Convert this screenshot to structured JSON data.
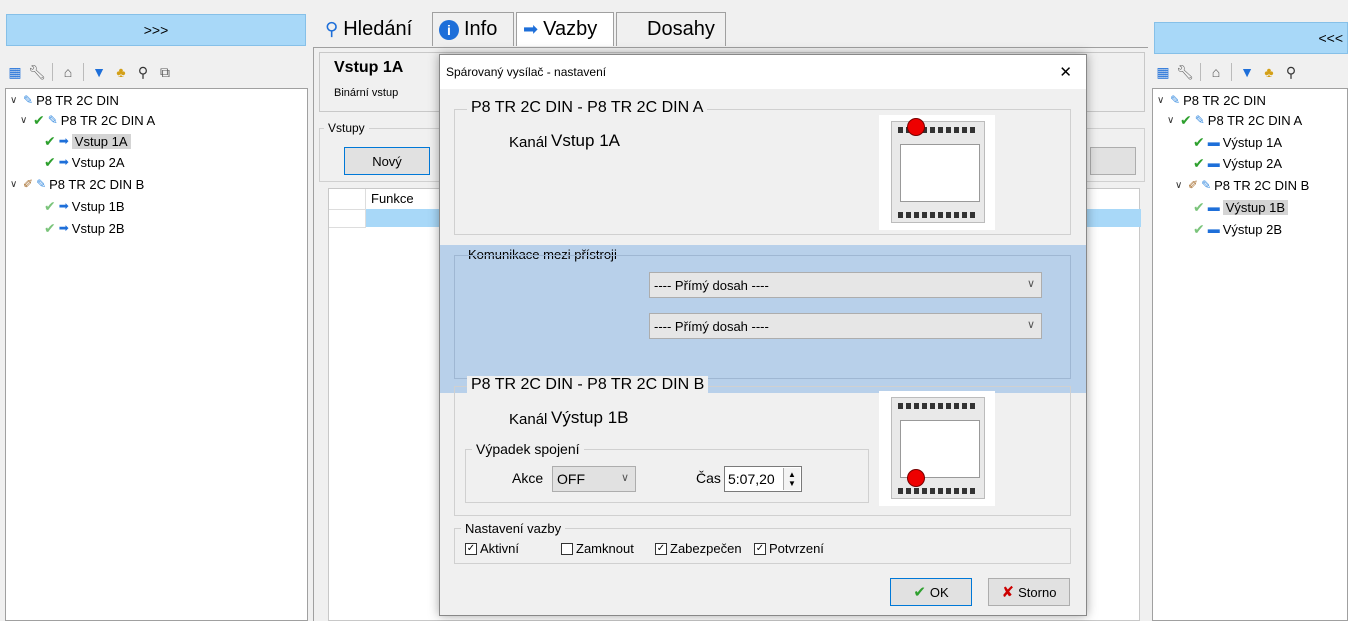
{
  "left_panel": {
    "collapse_label": ">>>",
    "tree": [
      {
        "label": "P8 TR 2C DIN"
      },
      {
        "label": "P8 TR 2C DIN A"
      },
      {
        "label": "Vstup 1A"
      },
      {
        "label": "Vstup 2A"
      },
      {
        "label": "P8 TR 2C DIN B"
      },
      {
        "label": "Vstup 1B"
      },
      {
        "label": "Vstup 2B"
      }
    ]
  },
  "tabs": [
    {
      "label": "Hledání",
      "icon": "search-icon"
    },
    {
      "label": "Info",
      "icon": "info-icon"
    },
    {
      "label": "Vazby",
      "icon": "arrow-right-icon"
    },
    {
      "label": "Dosahy",
      "icon": ""
    }
  ],
  "middle": {
    "title": "Vstup 1A",
    "subtitle": "Binární vstup",
    "group_label": "Vstupy",
    "new_button": "Nový",
    "table_header": "Funkce"
  },
  "right_panel": {
    "collapse_label": "<<<",
    "tree": [
      {
        "label": "P8 TR 2C DIN"
      },
      {
        "label": "P8 TR 2C DIN A"
      },
      {
        "label": "Výstup 1A"
      },
      {
        "label": "Výstup 2A"
      },
      {
        "label": "P8 TR 2C DIN B"
      },
      {
        "label": "Výstup 1B"
      },
      {
        "label": "Výstup 2B"
      }
    ]
  },
  "dialog": {
    "title": "Spárovaný vysílač - nastavení",
    "close": "✕",
    "sender": {
      "group_title": "P8 TR 2C DIN - P8 TR 2C DIN A",
      "channel_label": "Kanál",
      "channel_value": "Vstup 1A"
    },
    "comm": {
      "group_title": "Komunikace mezi přístroji",
      "select1": "---- Přímý dosah ----",
      "select2": "---- Přímý dosah ----"
    },
    "receiver": {
      "group_title": "P8 TR 2C DIN - P8 TR 2C DIN B",
      "channel_label": "Kanál",
      "channel_value": "Výstup 1B",
      "outage_title": "Výpadek spojení",
      "action_label": "Akce",
      "action_value": "OFF",
      "time_label": "Čas",
      "time_value": "5:07,20"
    },
    "binding": {
      "group_title": "Nastavení vazby",
      "options": [
        {
          "label": "Aktivní",
          "checked": true
        },
        {
          "label": "Zamknout",
          "checked": false
        },
        {
          "label": "Zabezpečen",
          "checked": true
        },
        {
          "label": "Potvrzení",
          "checked": true
        }
      ]
    },
    "ok_label": "OK",
    "cancel_label": "Storno"
  },
  "colors": {
    "selection_blue": "#a8d8f8",
    "comm_band": "#b8d0ea",
    "led_red": "#e00000"
  }
}
